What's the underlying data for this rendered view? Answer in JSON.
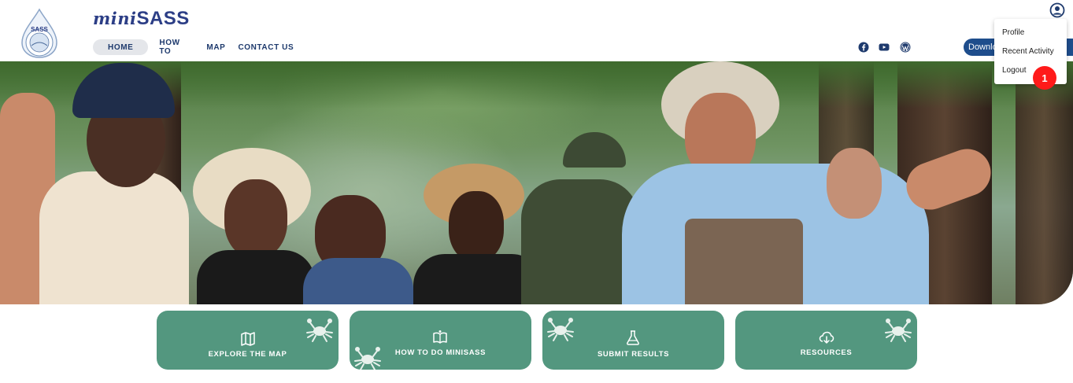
{
  "brand": {
    "mini": "mini",
    "sass": "SASS",
    "logo_text": "SASS"
  },
  "nav": {
    "items": [
      {
        "label": "HOME",
        "active": true
      },
      {
        "label": "HOW TO"
      },
      {
        "label": "MAP"
      },
      {
        "label": "CONTACT US"
      }
    ]
  },
  "social": [
    "facebook-icon",
    "youtube-icon",
    "wordpress-icon"
  ],
  "header": {
    "download_label": "Downlo"
  },
  "user_menu": {
    "items": [
      {
        "label": "Profile"
      },
      {
        "label": "Recent Activity"
      },
      {
        "label": "Logout"
      }
    ],
    "badge": "1"
  },
  "cards": [
    {
      "label": "EXPLORE THE MAP",
      "icon": "map-icon"
    },
    {
      "label": "HOW TO DO MINISASS",
      "icon": "book-icon"
    },
    {
      "label": "SUBMIT RESULTS",
      "icon": "flask-icon"
    },
    {
      "label": "RESOURCES",
      "icon": "cloud-download-icon"
    }
  ],
  "colors": {
    "brand_navy": "#2c3e86",
    "nav_text": "#1e3a6d",
    "card_green": "#53977f",
    "badge_red": "#ff1a1a",
    "download_blue": "#1e4d8c"
  }
}
